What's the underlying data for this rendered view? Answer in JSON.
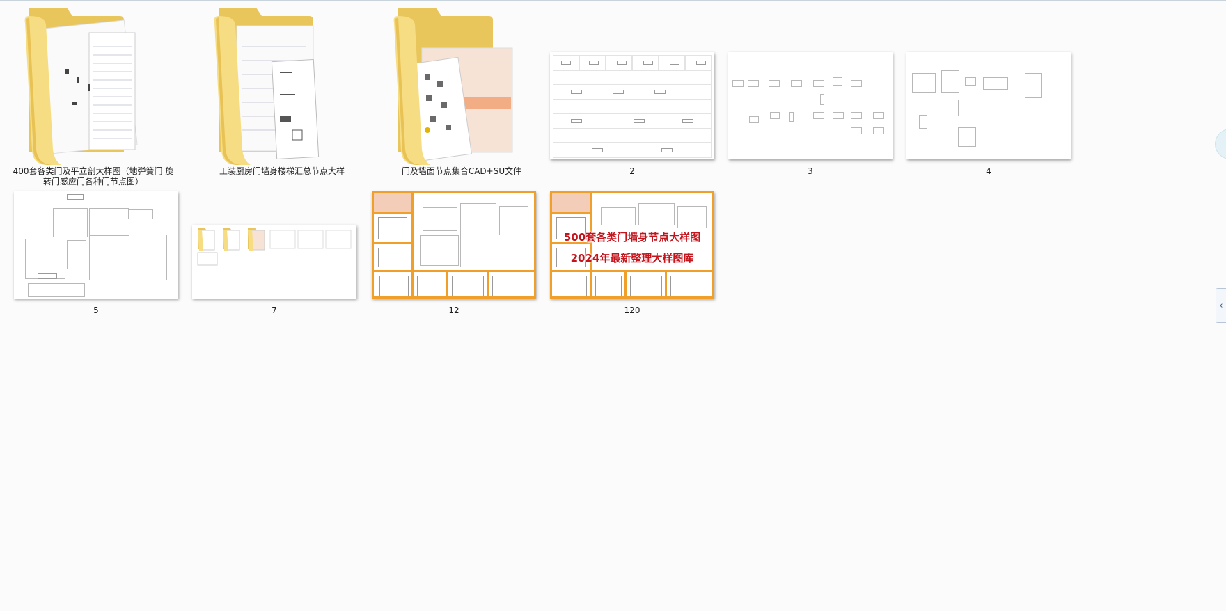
{
  "items": [
    {
      "kind": "folder",
      "label": "400套各类门及平立剖大样图（地弹簧门 旋转门感应门各种门节点图）"
    },
    {
      "kind": "folder",
      "label": "工装厨房门墙身楼梯汇总节点大样"
    },
    {
      "kind": "folder",
      "label": "门及墙面节点集合CAD+SU文件"
    },
    {
      "kind": "image",
      "label": "2"
    },
    {
      "kind": "image",
      "label": "3"
    },
    {
      "kind": "image",
      "label": "4"
    },
    {
      "kind": "image",
      "label": "5"
    },
    {
      "kind": "image",
      "label": "7"
    },
    {
      "kind": "image",
      "label": "12"
    },
    {
      "kind": "image",
      "label": "120"
    }
  ],
  "thumb120": {
    "line1": "500套各类门墙身节点大样图",
    "line2": "2024年最新整理大样图库"
  },
  "icons": {
    "folder": "folder-icon",
    "collapse": "chevron-left-icon"
  },
  "colors": {
    "folder": "#f3d77a",
    "accent_border": "#f0a02a",
    "title_red": "#c4141c"
  }
}
